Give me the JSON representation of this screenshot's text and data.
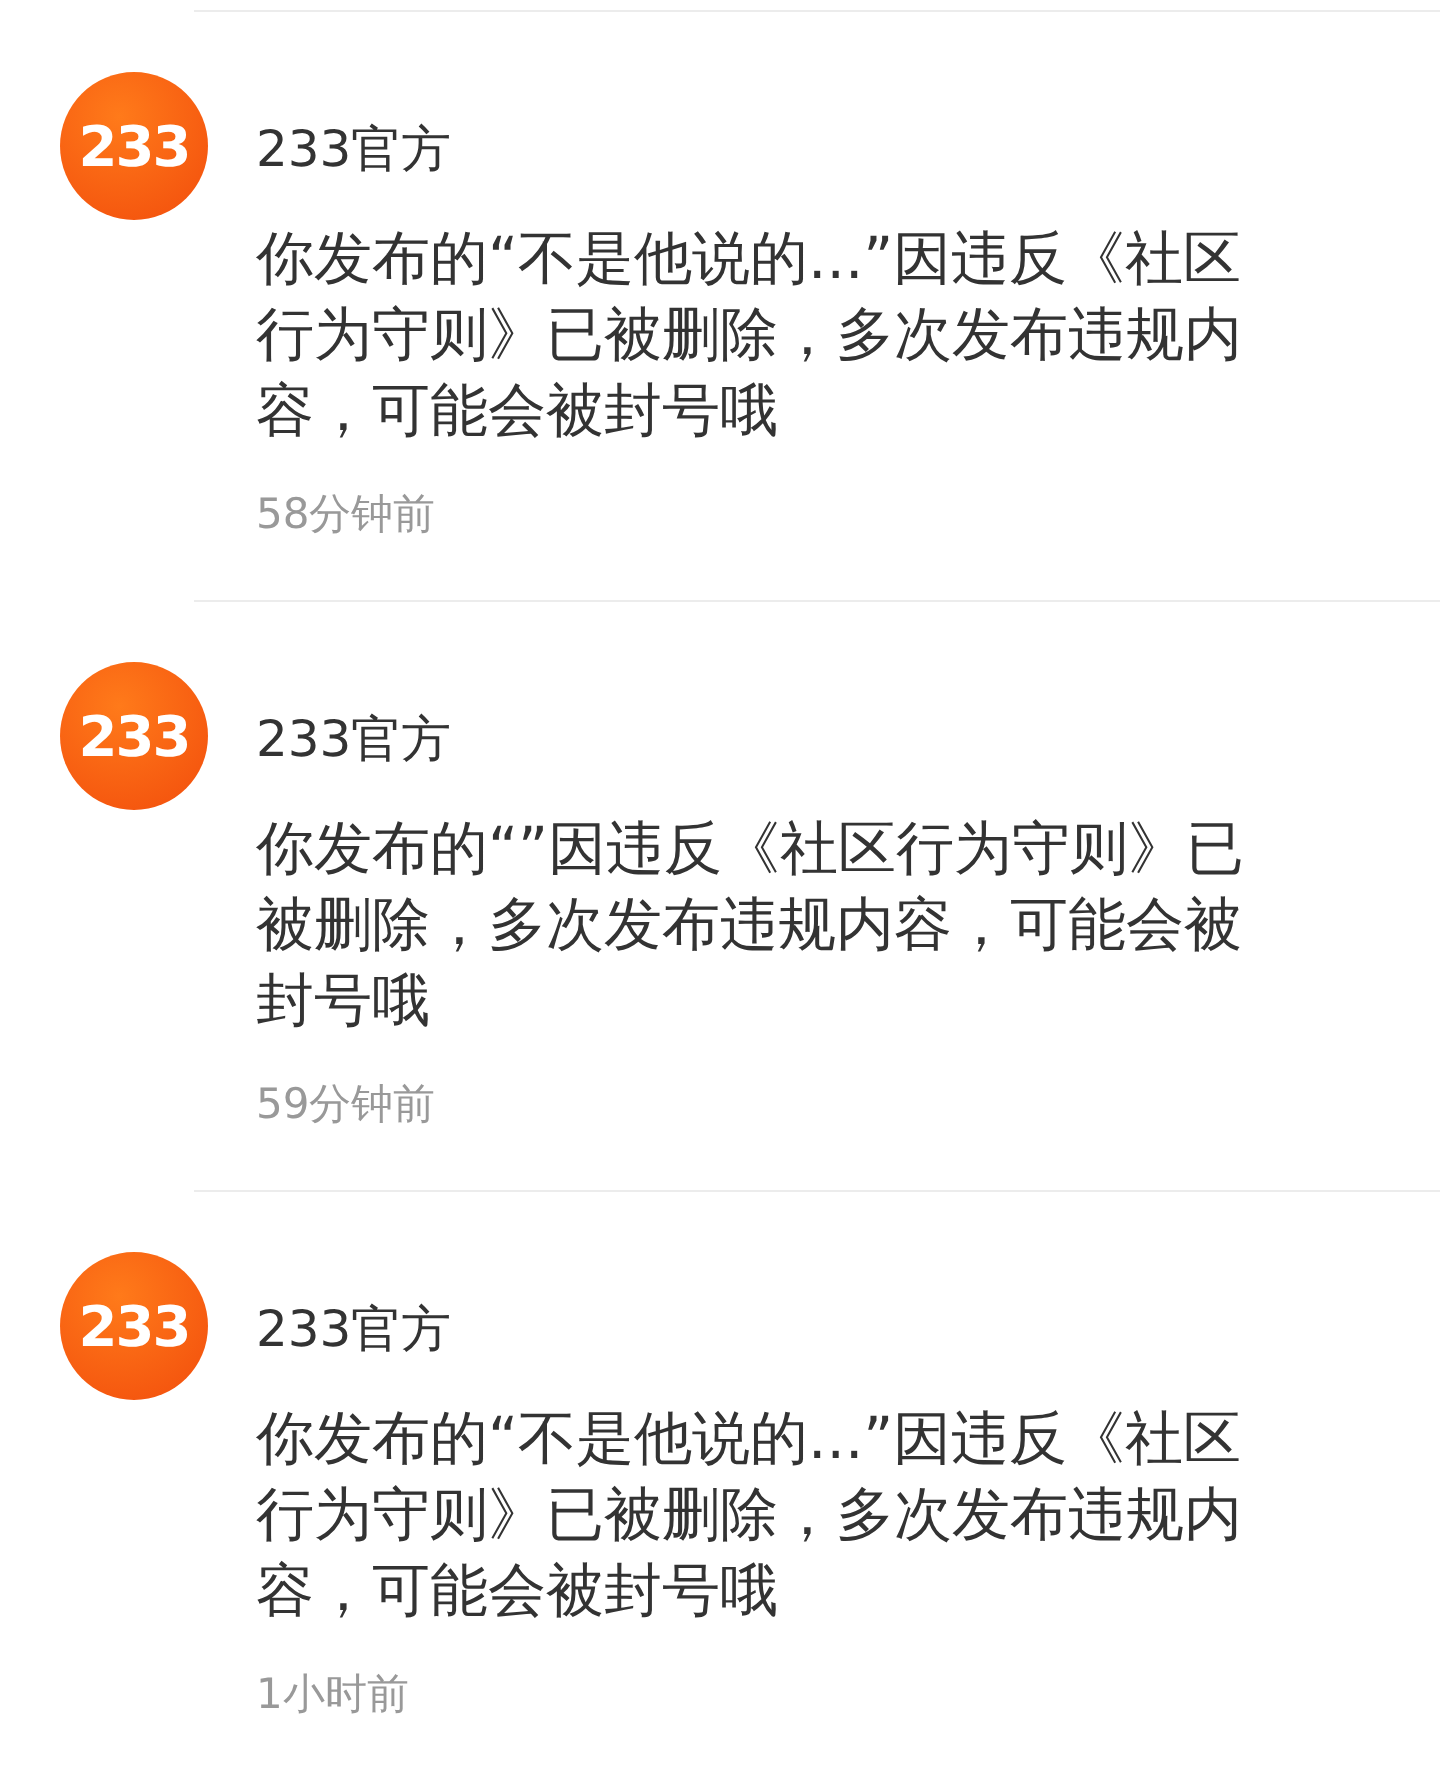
{
  "messages": [
    {
      "avatar": "233",
      "sender": "233官方",
      "text": "你发布的“不是他说的...”因违反《社区行为守则》已被删除，多次发布违规内容，可能会被封号哦",
      "time": "58分钟前"
    },
    {
      "avatar": "233",
      "sender": "233官方",
      "text": "你发布的“”因违反《社区行为守则》已被删除，多次发布违规内容，可能会被封号哦",
      "time": "59分钟前"
    },
    {
      "avatar": "233",
      "sender": "233官方",
      "text": "你发布的“不是他说的...”因违反《社区行为守则》已被删除，多次发布违规内容，可能会被封号哦",
      "time": "1小时前"
    }
  ]
}
